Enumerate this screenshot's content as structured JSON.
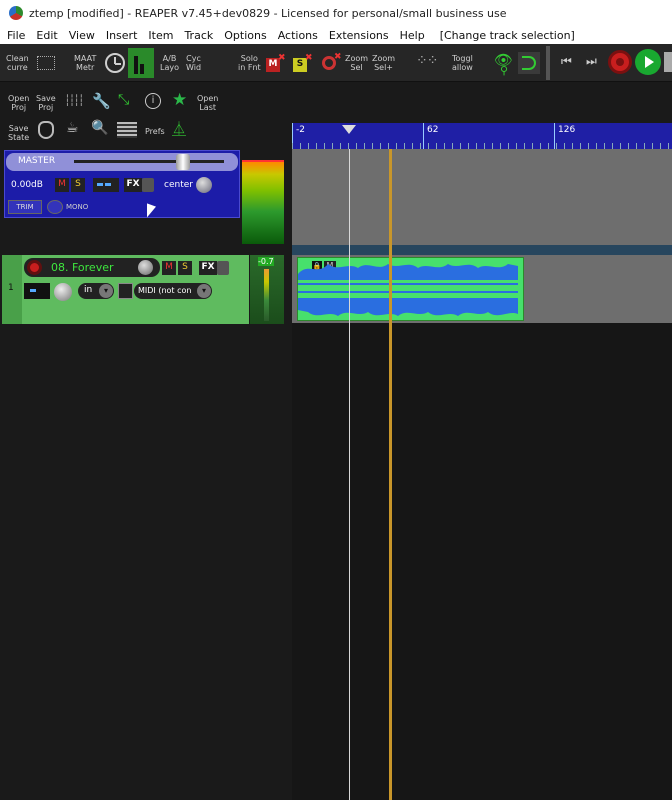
{
  "window": {
    "title": "ztemp [modified] - REAPER v7.45+dev0829 - Licensed for personal/small business use"
  },
  "menu": [
    "File",
    "Edit",
    "View",
    "Insert",
    "Item",
    "Track",
    "Options",
    "Actions",
    "Extensions",
    "Help"
  ],
  "menu_tail": "[Change track selection]",
  "toolbar": {
    "clean_cur": [
      "Clean",
      "curre"
    ],
    "maat": [
      "MAAT",
      "Metr"
    ],
    "ab": [
      "A/B",
      "Layo"
    ],
    "cyc": [
      "Cyc",
      "Wid"
    ],
    "solo": [
      "Solo",
      "in Fnt"
    ],
    "zoom_sel": [
      "Zoom",
      "Sel"
    ],
    "zoom_selp": [
      "Zoom",
      "Sel+"
    ],
    "toggle": [
      "Toggl",
      "allow"
    ],
    "m_badge": "M",
    "s_badge": "S"
  },
  "leftpanel": {
    "open_proj": [
      "Open",
      "Proj"
    ],
    "save_proj": [
      "Save",
      "Proj"
    ],
    "open_last": [
      "Open",
      "Last"
    ],
    "save_state": [
      "Save",
      "State"
    ],
    "prefs": "Prefs"
  },
  "ruler": {
    "labels": [
      "-2",
      "62",
      "126"
    ]
  },
  "master": {
    "name": "MASTER",
    "volume": "0.00dB",
    "m": "M",
    "s": "S",
    "fx": "FX",
    "pan": "center",
    "trim": "TRIM",
    "mono": "MONO"
  },
  "track": {
    "number": "1",
    "name": "08. Forever",
    "m": "M",
    "s": "S",
    "fx": "FX",
    "input": "in",
    "midi": "MIDI (not con",
    "meter_peak": "-0.7"
  },
  "clip": {
    "m": "M"
  },
  "colors": {
    "ruler": "#1f1fa5",
    "master_bg": "#1c1ca8",
    "track_bg": "#5fbb5f",
    "clip_bg": "#47e06c",
    "wave": "#2a6ee0",
    "cursor": "#c8962a"
  }
}
